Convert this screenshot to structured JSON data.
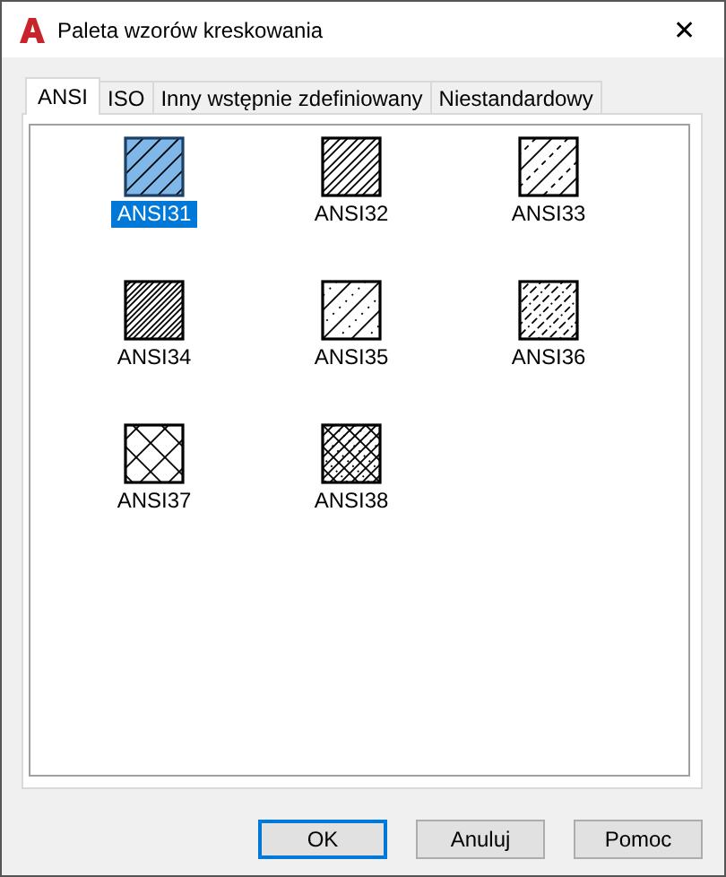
{
  "window": {
    "title": "Paleta wzorów kreskowania",
    "close": "✕"
  },
  "tabs": [
    {
      "label": "ANSI",
      "selected": true
    },
    {
      "label": "ISO",
      "selected": false
    },
    {
      "label": "Inny wstępnie zdefiniowany",
      "selected": false
    },
    {
      "label": "Niestandardowy",
      "selected": false
    }
  ],
  "patterns": [
    {
      "name": "ANSI31",
      "kind": "single",
      "selected": true
    },
    {
      "name": "ANSI32",
      "kind": "double",
      "selected": false
    },
    {
      "name": "ANSI33",
      "kind": "dashed",
      "selected": false
    },
    {
      "name": "ANSI34",
      "kind": "triple",
      "selected": false
    },
    {
      "name": "ANSI35",
      "kind": "dotted",
      "selected": false
    },
    {
      "name": "ANSI36",
      "kind": "dashdot",
      "selected": false
    },
    {
      "name": "ANSI37",
      "kind": "cross",
      "selected": false
    },
    {
      "name": "ANSI38",
      "kind": "densecross",
      "selected": false
    }
  ],
  "buttons": [
    {
      "label": "OK",
      "default": true
    },
    {
      "label": "Anuluj",
      "default": false
    },
    {
      "label": "Pomoc",
      "default": false
    }
  ]
}
